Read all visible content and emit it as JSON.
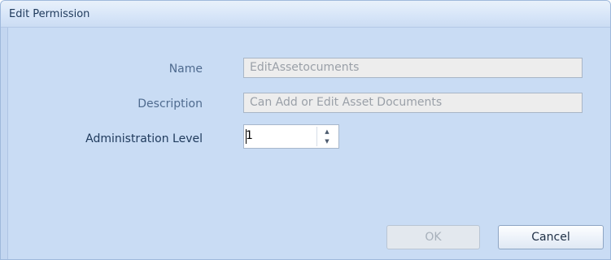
{
  "window": {
    "title": "Edit Permission"
  },
  "form": {
    "name_label": "Name",
    "name_value": "EditAssetocuments",
    "description_label": "Description",
    "description_value": "Can Add or Edit Asset Documents",
    "admin_level_label": "Administration Level",
    "admin_level_value": "1"
  },
  "buttons": {
    "ok_label": "OK",
    "cancel_label": "Cancel"
  },
  "icons": {
    "spin_up": "chevron-up-icon",
    "spin_down": "chevron-down-icon"
  }
}
